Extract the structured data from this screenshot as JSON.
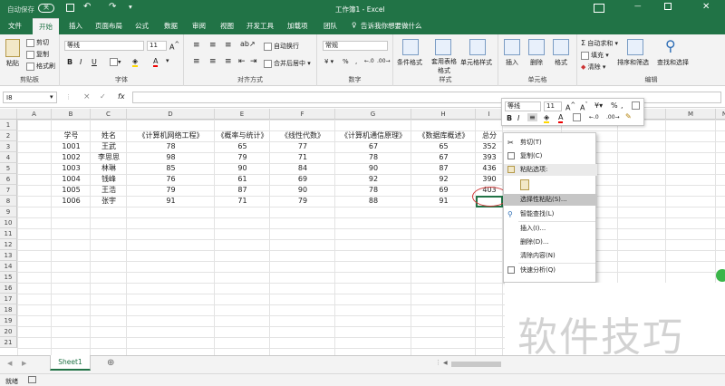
{
  "titlebar": {
    "autosave": "自动保存",
    "autosave_state": "关",
    "title": "工作簿1 - Excel"
  },
  "tabs": [
    "文件",
    "开始",
    "插入",
    "页面布局",
    "公式",
    "数据",
    "审阅",
    "视图",
    "开发工具",
    "加载项",
    "团队"
  ],
  "tell_me": "告诉我你想要做什么",
  "ribbon": {
    "clipboard": {
      "label": "剪贴板",
      "paste": "粘贴",
      "cut": "剪切",
      "copy": "复制",
      "format_painter": "格式刷"
    },
    "font": {
      "label": "字体",
      "font_name": "等线",
      "font_size": "11",
      "bold": "B",
      "italic": "I",
      "underline": "U",
      "font_color_glyph": "A"
    },
    "alignment": {
      "label": "对齐方式",
      "wrap": "自动换行",
      "merge": "合并后居中"
    },
    "number": {
      "label": "数字",
      "format": "常规"
    },
    "styles": {
      "label": "样式",
      "conditional": "条件格式",
      "table": "套用表格格式",
      "cell_styles": "单元格样式"
    },
    "cells": {
      "label": "单元格",
      "insert": "插入",
      "delete": "删除",
      "format": "格式"
    },
    "editing": {
      "label": "编辑",
      "autosum": "自动求和",
      "fill": "填充",
      "clear": "清除",
      "sort": "排序和筛选",
      "find": "查找和选择"
    }
  },
  "formula_bar": {
    "name_box": "I8",
    "cancel": "×",
    "enter": "✓",
    "fx": "fx"
  },
  "columns": [
    "A",
    "B",
    "C",
    "D",
    "E",
    "F",
    "G",
    "H",
    "I",
    "J",
    "K",
    "L",
    "M",
    "N"
  ],
  "rows": [
    "1",
    "2",
    "3",
    "4",
    "5",
    "6",
    "7",
    "8",
    "9",
    "10",
    "11",
    "12",
    "13",
    "14",
    "15",
    "16",
    "17",
    "18",
    "19",
    "20",
    "21"
  ],
  "table": {
    "headers": [
      "学号",
      "姓名",
      "《计算机网络工程》",
      "《概率与统计》",
      "《线性代数》",
      "《计算机通信原理》",
      "《数据库概述》",
      "总分"
    ],
    "rows": [
      [
        "1001",
        "王武",
        "78",
        "65",
        "77",
        "67",
        "65",
        "352"
      ],
      [
        "1002",
        "李思思",
        "98",
        "79",
        "71",
        "78",
        "67",
        "393"
      ],
      [
        "1003",
        "林琳",
        "85",
        "90",
        "84",
        "90",
        "87",
        "436"
      ],
      [
        "1004",
        "钱峰",
        "76",
        "61",
        "69",
        "92",
        "92",
        "390"
      ],
      [
        "1005",
        "王浩",
        "79",
        "87",
        "90",
        "78",
        "69",
        "403"
      ],
      [
        "1006",
        "张宇",
        "91",
        "71",
        "79",
        "88",
        "91",
        ""
      ]
    ]
  },
  "mini_toolbar": {
    "font": "等线",
    "size": "11",
    "bold": "B",
    "italic": "I",
    "currency": "%",
    "comma": ","
  },
  "context_menu": {
    "items": [
      {
        "label": "剪切(T)",
        "icon": "scissors-icon"
      },
      {
        "label": "复制(C)",
        "icon": "copy-icon"
      },
      {
        "label": "粘贴选项:",
        "icon": "paste-icon"
      },
      {
        "label": "",
        "icon": "paste-clipboard-icon"
      },
      {
        "label": "选择性粘贴(S)...",
        "icon": ""
      },
      {
        "label": "智能查找(L)",
        "icon": "search-icon"
      },
      {
        "label": "插入(I)...",
        "icon": ""
      },
      {
        "label": "删除(D)...",
        "icon": ""
      },
      {
        "label": "清除内容(N)",
        "icon": ""
      },
      {
        "label": "快速分析(Q)",
        "icon": "quick-analysis-icon"
      }
    ]
  },
  "sheet_tabs": [
    "Sheet1"
  ],
  "status": "就绪",
  "watermark": "软件技巧",
  "colors": {
    "excel_green": "#217346",
    "annotation_red": "#d03a3a"
  }
}
